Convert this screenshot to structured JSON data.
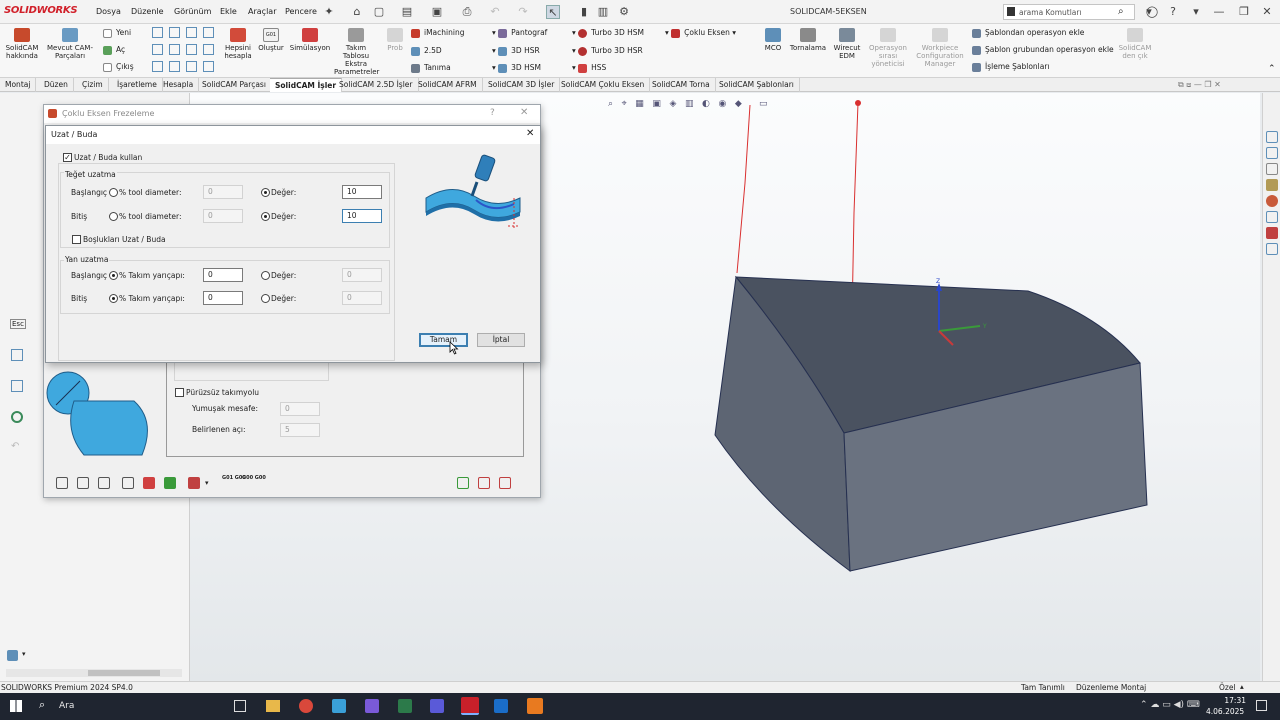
{
  "app": {
    "logo": "SOLIDWORKS",
    "menus": [
      "Dosya",
      "Düzenle",
      "Görünüm",
      "Ekle",
      "Araçlar",
      "Pencere"
    ],
    "doc_title": "SOLIDCAM-5EKSEN",
    "search_placeholder": "arama Komutları"
  },
  "ribbon": {
    "about": "SolidCAM hakkında",
    "parts": "Mevcut CAM-Parçaları",
    "file_items": [
      "Yeni",
      "Aç",
      "Çıkış"
    ],
    "calc_all": "Hepsini hesapla",
    "generate": "Oluştur",
    "simulation": "Simülasyon",
    "tool_table": "Takım Tablosu Ekstra Parametreler",
    "prob": "Prob",
    "col1": [
      "iMachining",
      "2.5D",
      "Tanıma"
    ],
    "col2": [
      "Pantograf",
      "3D HSR",
      "3D HSM"
    ],
    "col3": [
      "Turbo 3D HSM",
      "Turbo 3D HSR",
      "HSS"
    ],
    "multi_axis": "Çoklu Eksen",
    "mco": "MCO",
    "turning": "Tornalama",
    "wire_edm": "Wirecut EDM",
    "op_order": "Operasyon sırası yöneticisi",
    "workpiece_config": "Workpiece Configuration Manager",
    "templates": [
      "Şablondan operasyon ekle",
      "Şablon grubundan operasyon ekle",
      "İşleme Şablonları"
    ],
    "solidcam_out": "SolidCAM den çık"
  },
  "tabs": [
    "Montaj",
    "Düzen",
    "Çizim",
    "İşaretleme",
    "Hesapla",
    "SolidCAM Parçası",
    "SolidCAM İşler",
    "SolidCAM 2.5D İşler",
    "SolidCAM AFRM",
    "SolidCAM 3D İşler",
    "SolidCAM Çoklu Eksen",
    "SolidCAM Torna",
    "SolidCAM Şablonları"
  ],
  "active_tab": "SolidCAM İşler",
  "bg_dialog": {
    "title": "Çoklu Eksen Frezeleme",
    "smooth_check": "Pürüzsüz takımyolu",
    "smooth_distance_label": "Yumuşak mesafe:",
    "smooth_distance_value": "0",
    "angle_label": "Belirlenen açı:",
    "angle_value": "5",
    "gcode_a": "G01 G00",
    "gcode_b": "G00 G00"
  },
  "dialog": {
    "title": "Uzat / Buda",
    "use_check": "Uzat / Buda kullan",
    "tangent_group": "Teğet uzatma",
    "start_label": "Başlangıç",
    "end_label": "Bitiş",
    "pct_tool_diameter": "% tool diameter:",
    "pct_start_value": "0",
    "pct_end_value": "0",
    "value_label": "Değer:",
    "value_start": "10",
    "value_end": "10",
    "gaps_check": "Boşlukları Uzat / Buda",
    "side_group": "Yan uzatma",
    "pct_tool_radius": "% Takım yarıçapı:",
    "side_pct_start": "0",
    "side_pct_end": "0",
    "side_value_start": "0",
    "side_value_end": "0",
    "ok": "Tamam",
    "cancel": "İptal",
    "help": "?"
  },
  "status": {
    "left": "SOLIDWORKS Premium 2024 SP4.0",
    "defined": "Tam Tanımlı",
    "mode": "Düzenleme Montaj",
    "custom": "Özel"
  },
  "taskbar": {
    "search": "Ara",
    "time": "17:31",
    "date": "4.06.2025"
  },
  "colors": {
    "brand": "#d1202a",
    "part_top": "#4a5260",
    "part_side": "#6a7280",
    "toolpath": "#d92f2f"
  }
}
